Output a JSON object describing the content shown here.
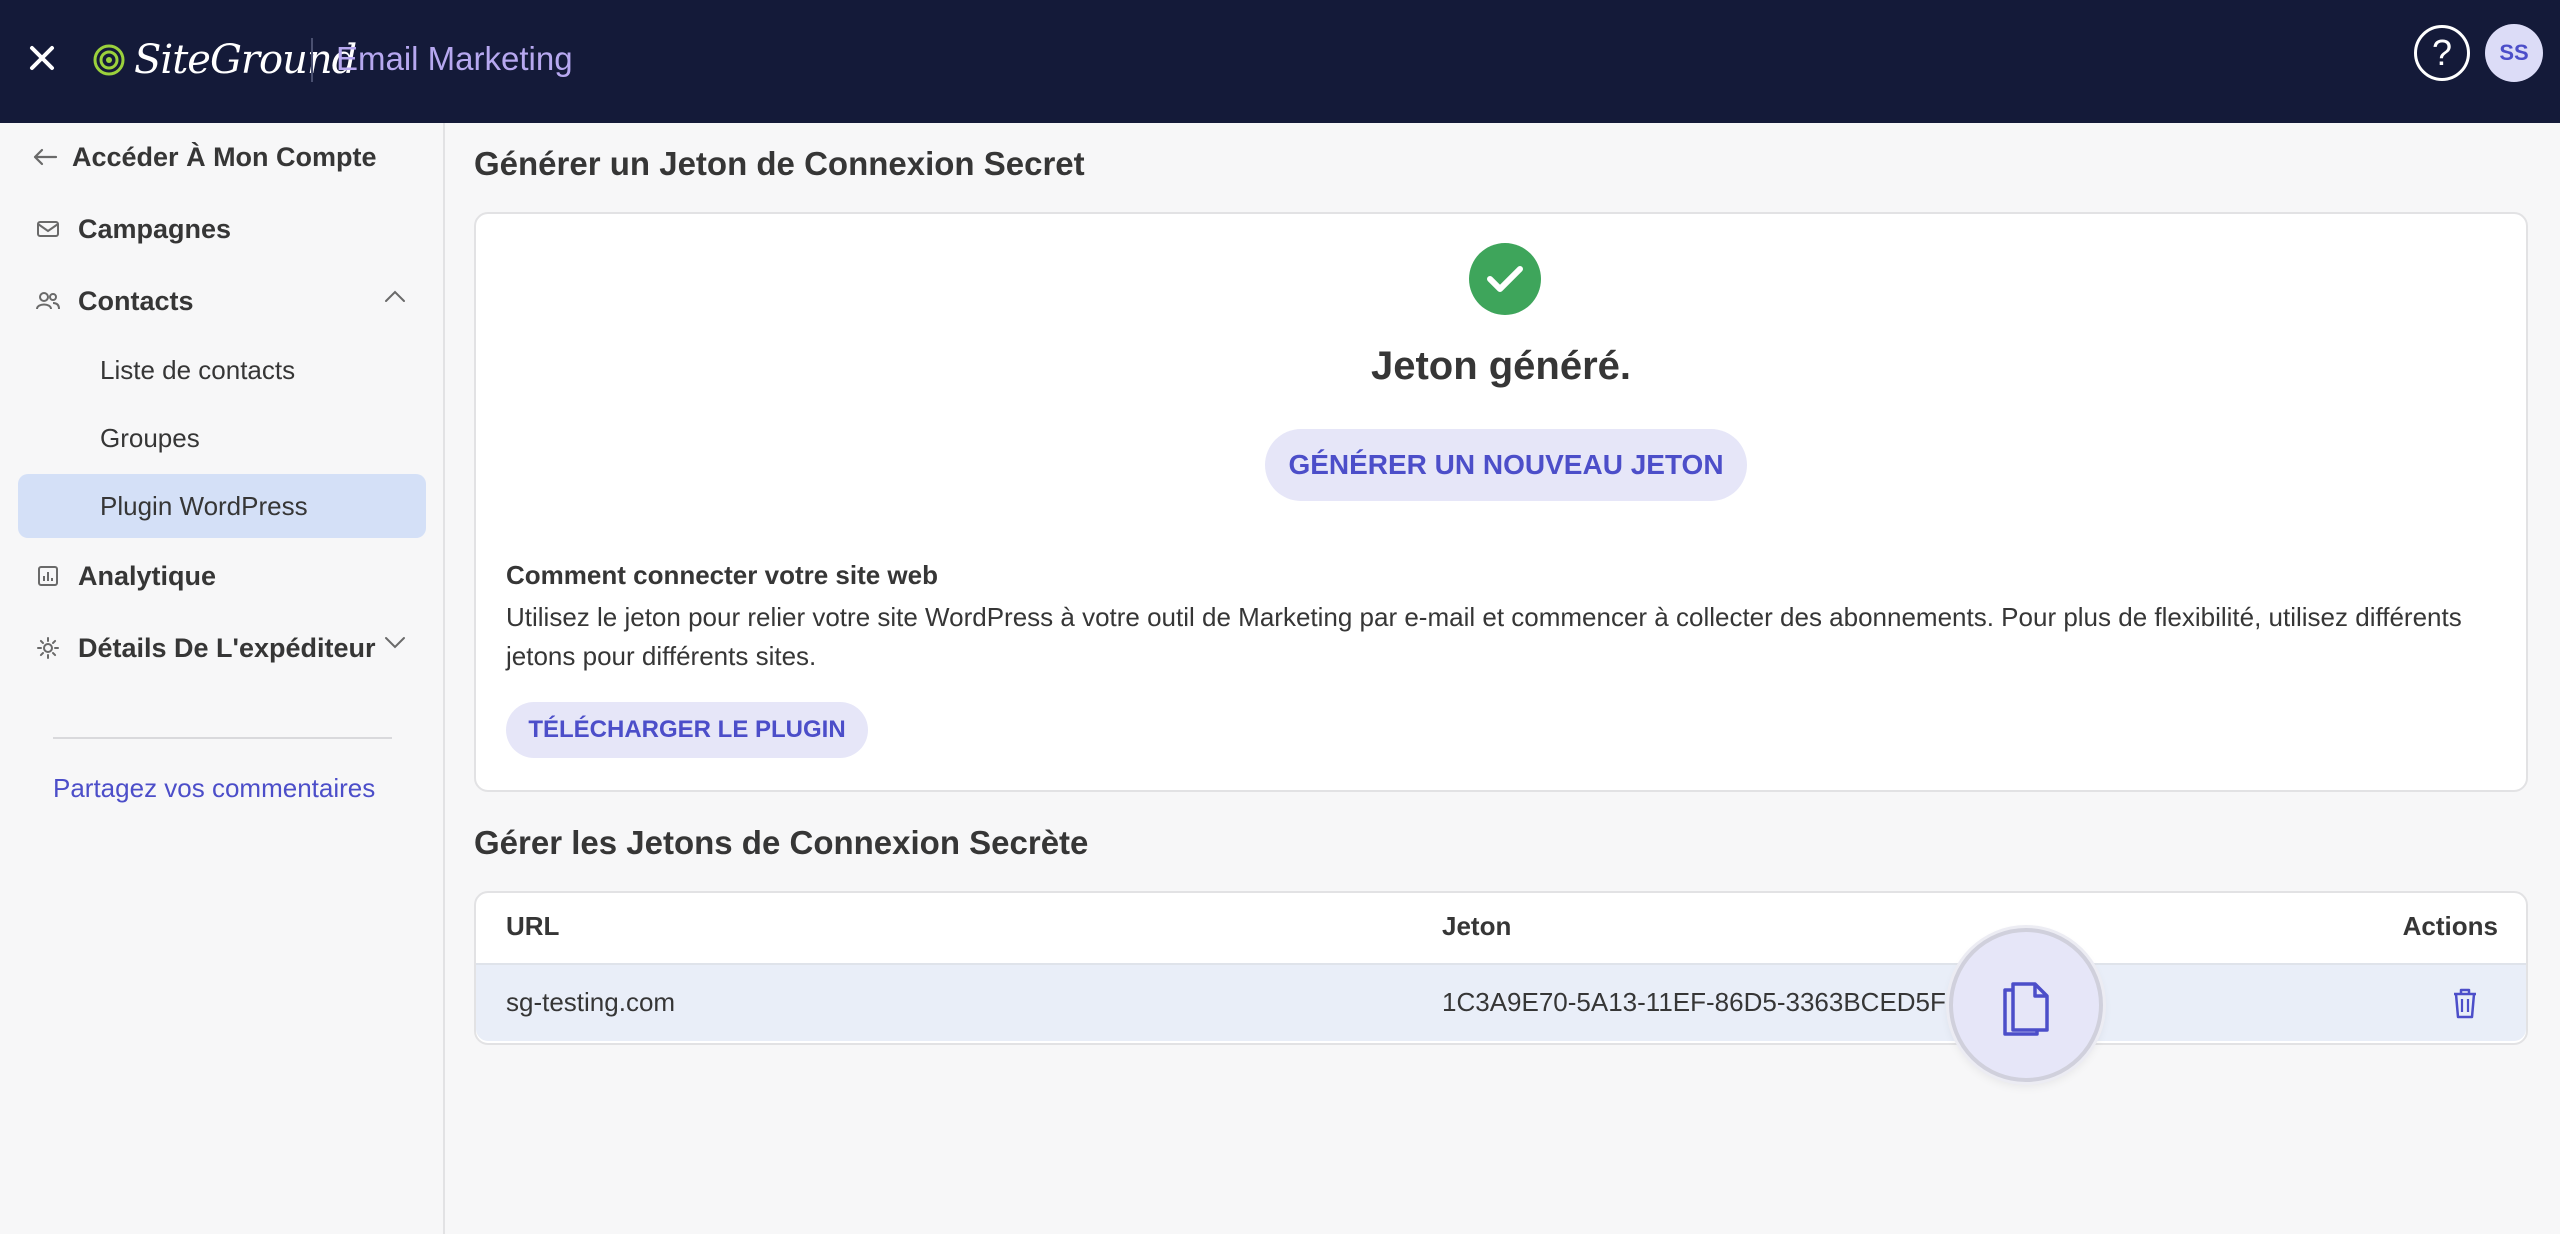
{
  "header": {
    "logo_text": "SiteGround",
    "app_name": "Email Marketing",
    "help_icon": "question-circle-icon",
    "avatar_initials": "SS",
    "brand_color": "#141a39"
  },
  "sidebar": {
    "back_label": "Accéder À Mon Compte",
    "items": [
      {
        "label": "Campagnes",
        "icon": "mail-icon"
      },
      {
        "label": "Contacts",
        "icon": "contacts-icon"
      },
      {
        "label": "Analytique",
        "icon": "chart-icon"
      },
      {
        "label": "Détails De L'expéditeur",
        "icon": "gear-icon"
      }
    ],
    "contacts_sub": [
      {
        "label": "Liste de contacts"
      },
      {
        "label": "Groupes"
      },
      {
        "label": "Plugin WordPress",
        "active": true
      }
    ],
    "feedback_label": "Partagez vos commentaires"
  },
  "generate": {
    "section_title": "Générer un Jeton de Connexion Secret",
    "status_title": "Jeton généré.",
    "new_token_button": "GÉNÉRER UN NOUVEAU JETON",
    "how_title": "Comment connecter votre site web",
    "how_text": "Utilisez le jeton pour relier votre site WordPress à votre outil de Marketing par e-mail et commencer à collecter des abonnements. Pour plus de flexibilité, utilisez différents jetons pour différents sites.",
    "download_button": "TÉLÉCHARGER LE PLUGIN",
    "success_color": "#3ea55b"
  },
  "manage": {
    "section_title": "Gérer les Jetons de Connexion Secrète",
    "columns": [
      "URL",
      "Jeton",
      "Actions"
    ],
    "rows": [
      {
        "url": "sg-testing.com",
        "token": "1C3A9E70-5A13-11EF-86D5-3363BCED5F"
      }
    ]
  },
  "accent_color": "#4c4ec9"
}
